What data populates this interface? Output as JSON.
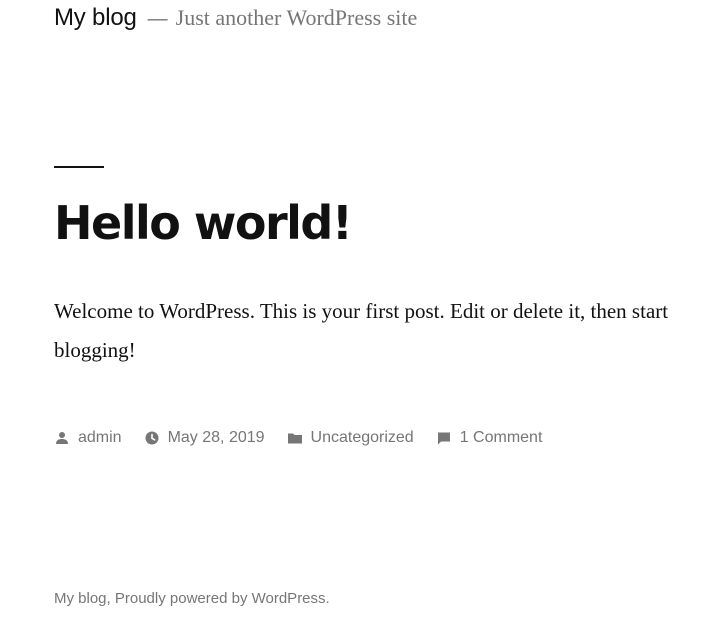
{
  "header": {
    "site_title": "My blog",
    "separator": "—",
    "site_description": "Just another WordPress site"
  },
  "post": {
    "title": "Hello world!",
    "content": "Welcome to WordPress. This is your first post. Edit or delete it, then start blogging!",
    "meta": {
      "author": "admin",
      "date": "May 28, 2019",
      "category": "Uncategorized",
      "comments": "1 Comment"
    }
  },
  "footer": {
    "site_name": "My blog,",
    "powered_by": "Proudly powered by WordPress."
  },
  "colors": {
    "text": "#111111",
    "muted": "#767676",
    "background": "#ffffff"
  },
  "icons": {
    "author": "person-icon",
    "date": "clock-icon",
    "category": "folder-icon",
    "comments": "comment-icon"
  }
}
